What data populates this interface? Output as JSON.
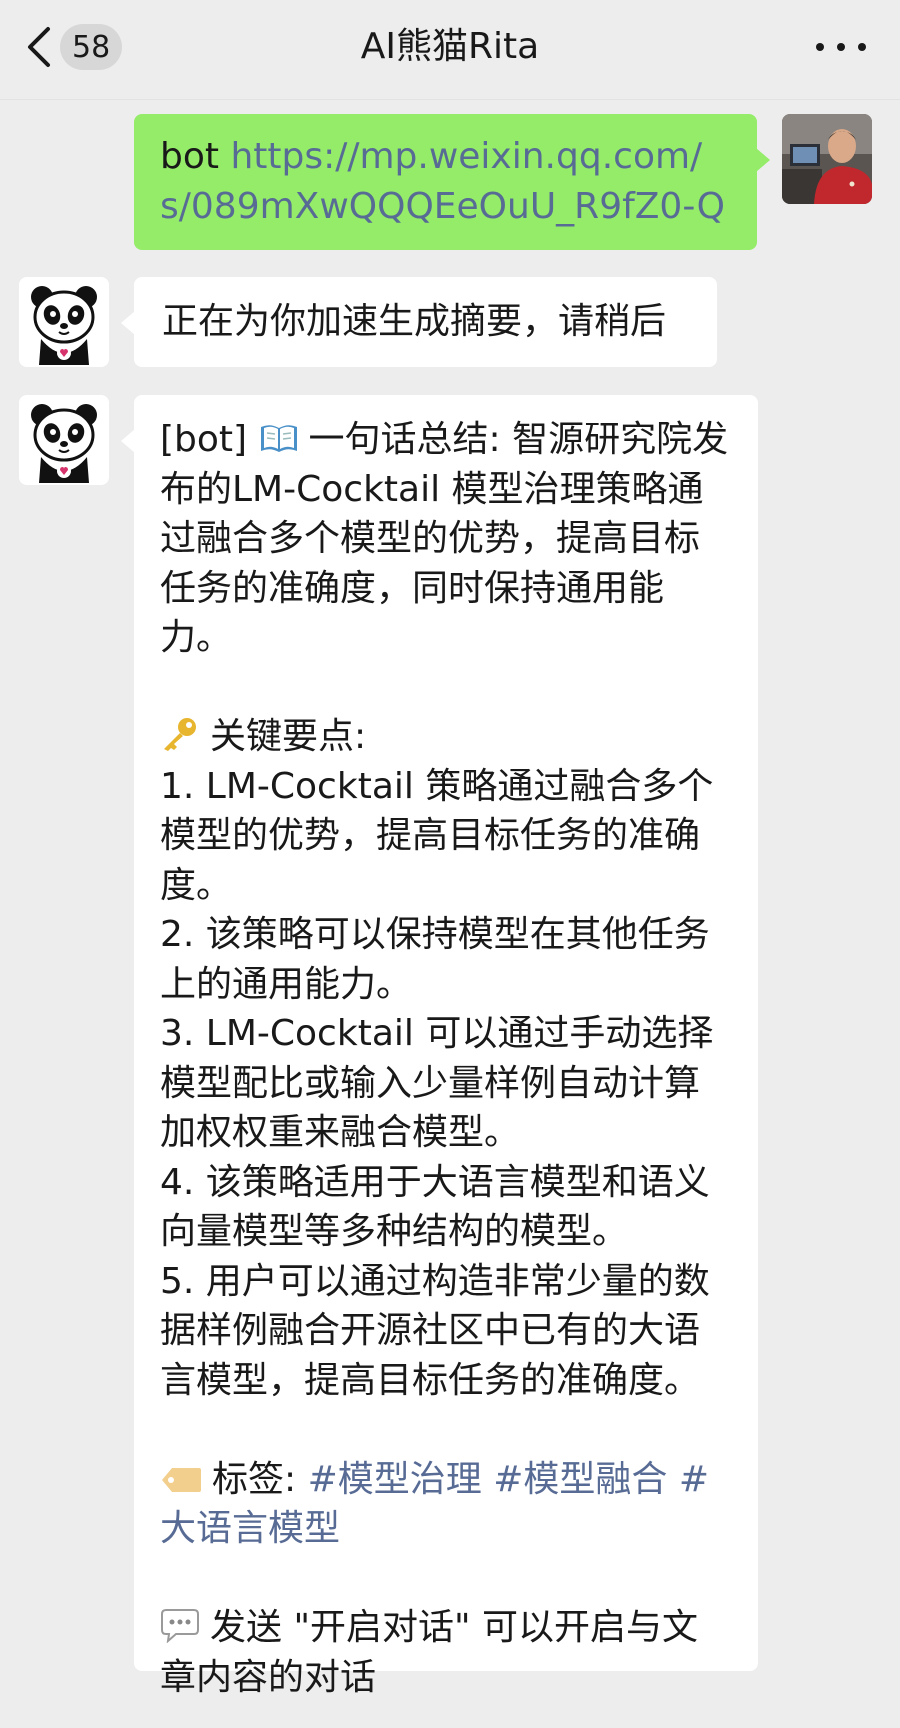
{
  "header": {
    "unread_count": "58",
    "title": "AI熊猫Rita"
  },
  "messages": {
    "sent": {
      "prefix": "bot ",
      "url": "https://mp.weixin.qq.com/s/089mXwQQQEeOuU_R9fZ0-Q"
    },
    "status": {
      "text": "正在为你加速生成摘要，请稍后"
    },
    "summary": {
      "summary_prefix": "[bot]",
      "summary_text": "一句话总结: 智源研究院发布的LM-Cocktail 模型治理策略通过融合多个模型的优势，提高目标任务的准确度，同时保持通用能力。",
      "keypoints_heading": "关键要点:",
      "keypoints": [
        "1. LM-Cocktail 策略通过融合多个模型的优势，提高目标任务的准确度。",
        "2. 该策略可以保持模型在其他任务上的通用能力。",
        "3. LM-Cocktail 可以通过手动选择模型配比或输入少量样例自动计算加权权重来融合模型。",
        "4. 该策略适用于大语言模型和语义向量模型等多种结构的模型。",
        "5. 用户可以通过构造非常少量的数据样例融合开源社区中已有的大语言模型，提高目标任务的准确度。"
      ],
      "tags_label": "标签:",
      "tags": [
        "#模型治理",
        "#模型融合",
        "#大语言模型"
      ],
      "footer_text": "发送 \"开启对话\" 可以开启与文章内容的对话"
    }
  },
  "icons": {
    "back": "chevron-left-icon",
    "more": "more-dots-icon",
    "book": "open-book-icon",
    "key": "key-icon",
    "tag": "label-tag-icon",
    "speech": "speech-bubble-icon"
  },
  "colors": {
    "sent_bubble": "#95ec69",
    "received_bubble": "#ffffff",
    "link": "#576b95",
    "background": "#ededed"
  }
}
